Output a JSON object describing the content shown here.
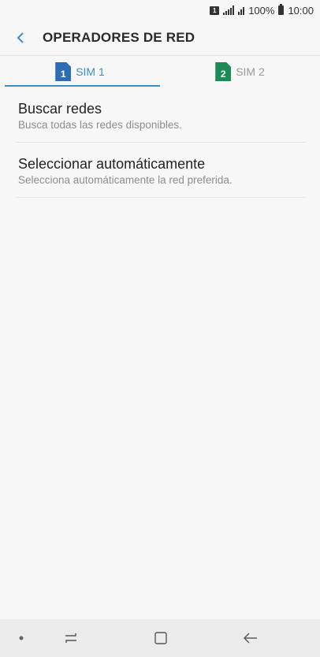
{
  "status_bar": {
    "sim_badge": "1",
    "battery_text": "100%",
    "time": "10:00"
  },
  "header": {
    "title": "OPERADORES DE RED",
    "back_icon": "chevron-left-icon"
  },
  "tabs": [
    {
      "label": "SIM 1",
      "sim_number": "1",
      "active": true,
      "color": "#2d6db3"
    },
    {
      "label": "SIM 2",
      "sim_number": "2",
      "active": false,
      "color": "#1e8a55"
    }
  ],
  "accent_color": "#3a8fc4",
  "items": [
    {
      "title": "Buscar redes",
      "subtitle": "Busca todas las redes disponibles."
    },
    {
      "title": "Seleccionar automáticamente",
      "subtitle": "Selecciona automáticamente la red preferida."
    }
  ],
  "nav_bar": {
    "icons": [
      "dot-icon",
      "recent-apps-icon",
      "home-icon",
      "back-arrow-icon"
    ]
  }
}
